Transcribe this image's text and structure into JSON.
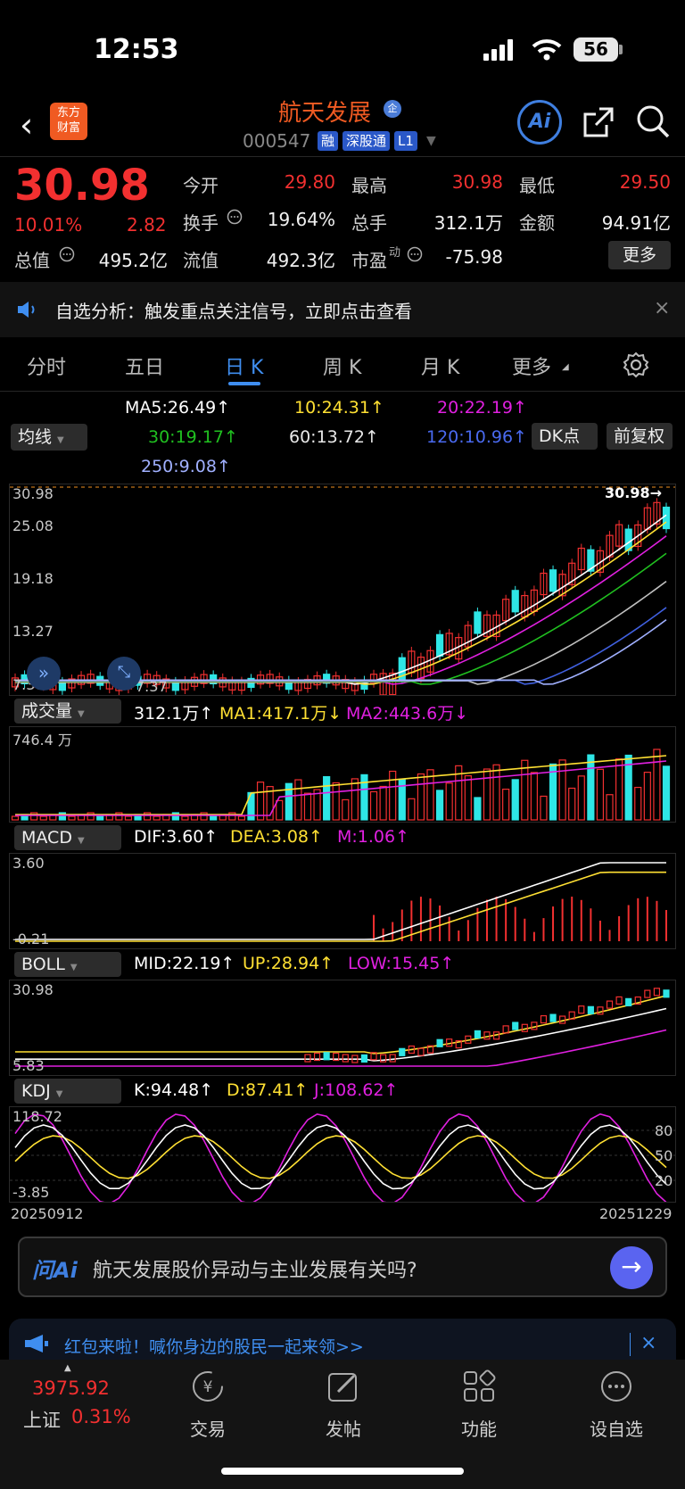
{
  "status_bar": {
    "time": "12:53",
    "battery": "56"
  },
  "header": {
    "logo_line1": "东方",
    "logo_line2": "财富",
    "stock_name": "航天发展",
    "qi_badge": "企",
    "stock_code": "000547",
    "tags": [
      "融",
      "深股通",
      "L1"
    ],
    "ai_label": "Ai"
  },
  "quote": {
    "price": "30.98",
    "change_pct": "10.01%",
    "change": "2.82",
    "fields": [
      {
        "label": "今开",
        "value": "29.80",
        "color": "#f23030"
      },
      {
        "label": "最高",
        "value": "30.98",
        "color": "#f23030"
      },
      {
        "label": "最低",
        "value": "29.50",
        "color": "#f23030"
      },
      {
        "label": "换手",
        "value": "19.64%",
        "color": "#f0f0f0"
      },
      {
        "label": "总手",
        "value": "312.1万",
        "color": "#f0f0f0"
      },
      {
        "label": "金额",
        "value": "94.91亿",
        "color": "#f0f0f0"
      },
      {
        "label": "总值",
        "value": "495.2亿",
        "color": "#f0f0f0"
      },
      {
        "label": "流值",
        "value": "492.3亿",
        "color": "#f0f0f0"
      },
      {
        "label": "市盈",
        "value": "-75.98",
        "color": "#f0f0f0"
      }
    ],
    "pe_superscript": "动",
    "more_label": "更多"
  },
  "notice": {
    "text": "自选分析：触发重点关注信号，立即点击查看",
    "close": "×"
  },
  "tabs": [
    "分时",
    "五日",
    "日 K",
    "周 K",
    "月 K",
    "更多"
  ],
  "active_tab": 2,
  "ma_panel": {
    "selector": "均线",
    "ma5": "MA5:26.49↑",
    "ma10": "10:24.31↑",
    "ma20": "20:22.19↑",
    "ma30": "30:19.17↑",
    "ma60": "60:13.72↑",
    "ma120": "120:10.96↑",
    "ma250": "250:9.08↑",
    "dk_btn": "DK点",
    "adjust_btn": "前复权"
  },
  "kline": {
    "y_labels": [
      "30.98",
      "25.08",
      "19.18",
      "13.27",
      "7.37"
    ],
    "last_label": "30.98→",
    "low_label": "7.37"
  },
  "volume": {
    "selector": "成交量",
    "vol": "312.1万↑",
    "ma1": "MA1:417.1万↓",
    "ma2": "MA2:443.6万↓",
    "max_label": "746.4 万"
  },
  "macd": {
    "selector": "MACD",
    "dif": "DIF:3.60↑",
    "dea": "DEA:3.08↑",
    "m": "M:1.06↑",
    "max_label": "3.60",
    "min_label": "-0.21"
  },
  "boll": {
    "selector": "BOLL",
    "mid": "MID:22.19↑",
    "up": "UP:28.94↑",
    "low": "LOW:15.45↑",
    "max_label": "30.98",
    "min_label": "5.83"
  },
  "kdj": {
    "selector": "KDJ",
    "k": "K:94.48↑",
    "d": "D:87.41↑",
    "j": "J:108.62↑",
    "max_label": "118.72",
    "min_label": "-3.85",
    "levels": [
      "80",
      "50",
      "20"
    ]
  },
  "dates": {
    "start": "20250912",
    "end": "20251229"
  },
  "ai_ask": {
    "logo": "问Ai",
    "question": "航天发展股价异动与主业发展有关吗?",
    "go": "→"
  },
  "promo": {
    "text": "红包来啦！喊你身边的股民一起来领>>",
    "close": "×"
  },
  "bottom_nav": {
    "index_value": "3975.92",
    "index_name": "上证",
    "index_pct": "0.31%",
    "items": [
      "交易",
      "发帖",
      "功能",
      "设自选"
    ]
  },
  "colors": {
    "up": "#f23030",
    "down": "#2ee6e6",
    "accent": "#3f8ef0",
    "ma5": "#ffffff",
    "ma10": "#ffe033",
    "ma20": "#e020e0",
    "ma30": "#20c020",
    "ma60": "#c0c0c0",
    "ma120": "#4060e0",
    "ma250": "#a0b0ff"
  }
}
